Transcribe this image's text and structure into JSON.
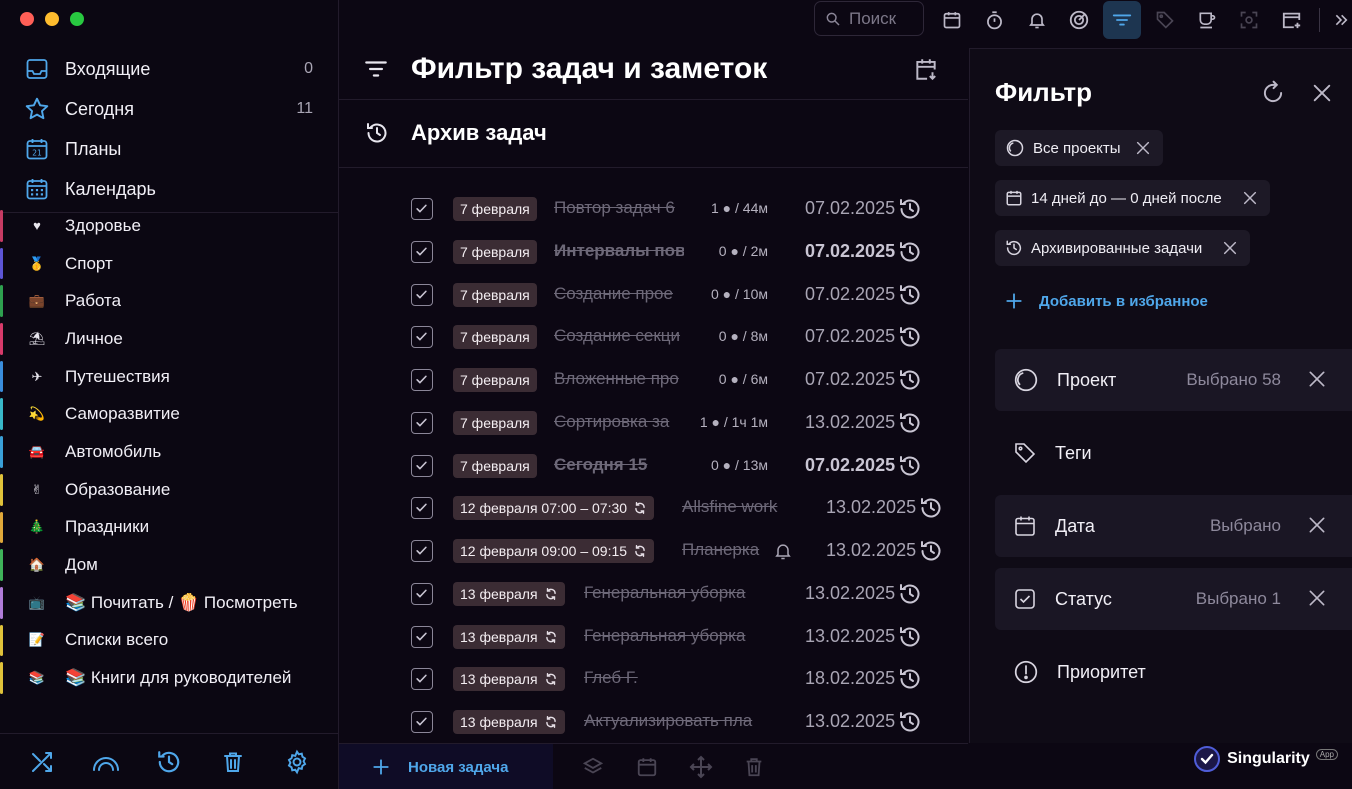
{
  "toolbar": {
    "search_placeholder": "Поиск"
  },
  "sidebar": {
    "nav": [
      {
        "label": "Входящие",
        "count": "0",
        "icon": "inbox-icon"
      },
      {
        "label": "Сегодня",
        "count": "11",
        "icon": "star-icon"
      },
      {
        "label": "Планы",
        "count": "",
        "icon": "calendar-21-icon"
      },
      {
        "label": "Календарь",
        "count": "",
        "icon": "calendar-grid-icon"
      }
    ],
    "projects": [
      {
        "label": "Здоровье",
        "color": "#c63b63",
        "emoji": "♥"
      },
      {
        "label": "Спорт",
        "color": "#5d55d6",
        "emoji": "🥇"
      },
      {
        "label": "Работа",
        "color": "#2ea04f",
        "emoji": "💼"
      },
      {
        "label": "Личное",
        "color": "#d83a6a",
        "emoji": "⛱"
      },
      {
        "label": "Путешествия",
        "color": "#3a8ddc",
        "emoji": "✈"
      },
      {
        "label": "Саморазвитие",
        "color": "#39b8c9",
        "emoji": "💫"
      },
      {
        "label": "Автомобиль",
        "color": "#3aa0d8",
        "emoji": "🚘"
      },
      {
        "label": "Образование",
        "color": "#e0c23a",
        "emoji": "✌"
      },
      {
        "label": "Праздники",
        "color": "#e0a83a",
        "emoji": "🎄"
      },
      {
        "label": "Дом",
        "color": "#3fb35a",
        "emoji": "🏠"
      },
      {
        "label": "📚 Почитать / 🍿 Посмотреть",
        "color": "#b07cd8",
        "emoji": "📺"
      },
      {
        "label": "Списки всего",
        "color": "#e0c23a",
        "emoji": "📝"
      },
      {
        "label": "📚 Книги для руководителей",
        "color": "#e0c23a",
        "emoji": "📚"
      }
    ]
  },
  "main": {
    "title": "Фильтр задач и заметок",
    "subtitle": "Архив задач",
    "new_task_label": "Новая задача",
    "tasks": [
      {
        "chip": "7 февраля",
        "title": "Повтор задач 6",
        "meta": "1 ● / 44м",
        "date": "07.02.2025",
        "bold": false,
        "repeat": false,
        "bell": false
      },
      {
        "chip": "7 февраля",
        "title": "Интервалы повт",
        "meta": "0 ● / 2м",
        "date": "07.02.2025",
        "bold": true,
        "repeat": false,
        "bell": false
      },
      {
        "chip": "7 февраля",
        "title": "Создание прое",
        "meta": "0 ● / 10м",
        "date": "07.02.2025",
        "bold": false,
        "repeat": false,
        "bell": false
      },
      {
        "chip": "7 февраля",
        "title": "Создание секци",
        "meta": "0 ● / 8м",
        "date": "07.02.2025",
        "bold": false,
        "repeat": false,
        "bell": false
      },
      {
        "chip": "7 февраля",
        "title": "Вложенные про",
        "meta": "0 ● / 6м",
        "date": "07.02.2025",
        "bold": false,
        "repeat": false,
        "bell": false
      },
      {
        "chip": "7 февраля",
        "title": "Сортировка за",
        "meta": "1 ● / 1ч 1м",
        "date": "13.02.2025",
        "bold": false,
        "repeat": false,
        "bell": false
      },
      {
        "chip": "7 февраля",
        "title": "Сегодня 15",
        "meta": "0 ● / 13м",
        "date": "07.02.2025",
        "bold": true,
        "repeat": false,
        "bell": false
      },
      {
        "chip": "12 февраля 07:00 – 07:30",
        "title": "Allsfine work",
        "meta": "",
        "date": "13.02.2025",
        "bold": false,
        "repeat": true,
        "bell": false
      },
      {
        "chip": "12 февраля 09:00 – 09:15",
        "title": "Планерка",
        "meta": "",
        "date": "13.02.2025",
        "bold": false,
        "repeat": true,
        "bell": true
      },
      {
        "chip": "13 февраля",
        "title": "Генеральная уборка",
        "meta": "",
        "date": "13.02.2025",
        "bold": false,
        "repeat": true,
        "bell": false
      },
      {
        "chip": "13 февраля",
        "title": "Генеральная уборка",
        "meta": "",
        "date": "13.02.2025",
        "bold": false,
        "repeat": true,
        "bell": false
      },
      {
        "chip": "13 февраля",
        "title": "Глеб Г.",
        "meta": "",
        "date": "18.02.2025",
        "bold": false,
        "repeat": true,
        "bell": false
      },
      {
        "chip": "13 февраля",
        "title": "Актуализировать пла",
        "meta": "",
        "date": "13.02.2025",
        "bold": false,
        "repeat": true,
        "bell": false
      }
    ]
  },
  "filter": {
    "title": "Фильтр",
    "chips": [
      "Все проекты",
      "14 дней до — 0 дней после",
      "Архивированные задачи"
    ],
    "add_favorite": "Добавить в избранное",
    "rows": [
      {
        "label": "Проект",
        "value": "Выбрано 58",
        "active": true,
        "icon": "project-circle-icon"
      },
      {
        "label": "Теги",
        "value": "",
        "active": false,
        "icon": "tag-icon"
      },
      {
        "label": "Дата",
        "value": "Выбрано",
        "active": true,
        "icon": "calendar-icon"
      },
      {
        "label": "Статус",
        "value": "Выбрано 1",
        "active": true,
        "icon": "checkbox-icon"
      },
      {
        "label": "Приоритет",
        "value": "",
        "active": false,
        "icon": "priority-icon"
      }
    ]
  },
  "brand": {
    "name": "Singularity",
    "badge": "App"
  },
  "colors": {
    "accent": "#4fa7ea",
    "chip_bg": "#3b2c34",
    "active_tool": "#1d3550"
  }
}
